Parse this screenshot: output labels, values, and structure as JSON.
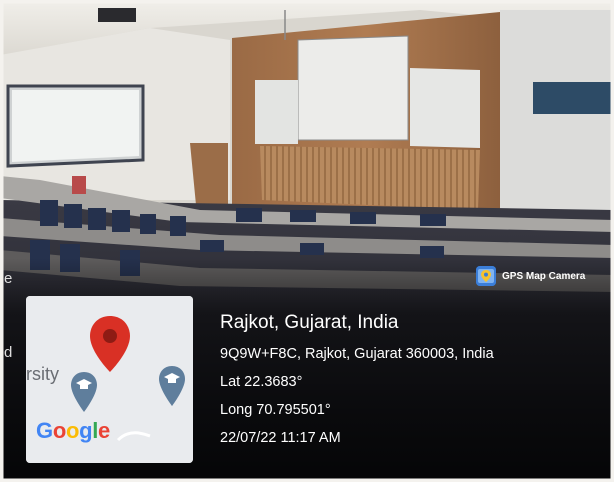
{
  "overlay": {
    "badge_label": "GPS Map Camera",
    "location_title": "Rajkot, Gujarat, India",
    "address": "9Q9W+F8C, Rajkot, Gujarat 360003, India",
    "latitude": "Lat 22.3683°",
    "longitude": "Long 70.795501°",
    "datetime": "22/07/22 11:17 AM"
  },
  "map": {
    "partial_label": "rsity",
    "logo_letters": [
      "G",
      "o",
      "o",
      "g",
      "l",
      "e"
    ],
    "logo_colors": [
      "#4285F4",
      "#EA4335",
      "#FBBC05",
      "#4285F4",
      "#34A853",
      "#EA4335"
    ],
    "pin_icon": "map-pin-icon",
    "university_icon": "graduation-cap-icon"
  },
  "edge_text": {
    "left_e": "e",
    "left_d": "d"
  },
  "colors": {
    "pin_red": "#d93025",
    "marker_blue": "#5f7e9c",
    "overlay_text": "#ffffff"
  }
}
